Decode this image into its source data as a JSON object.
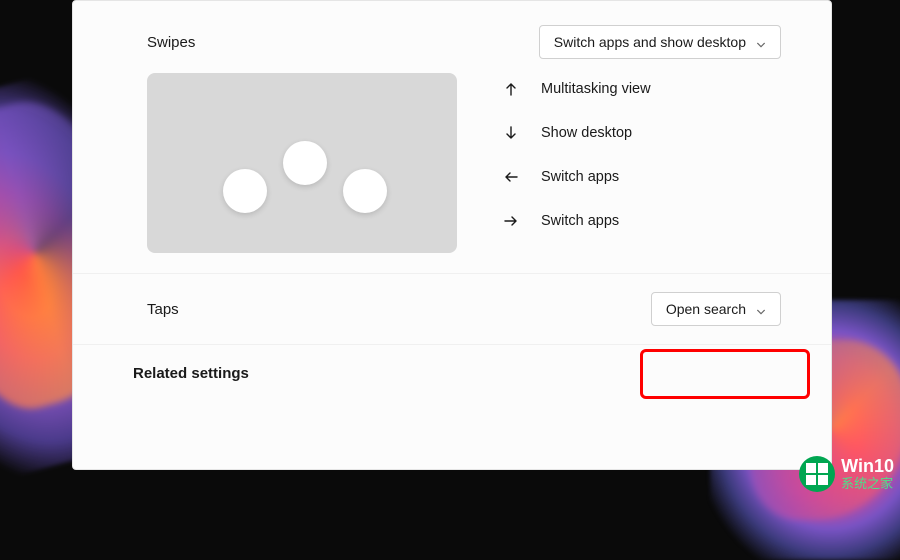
{
  "settings": {
    "swipes": {
      "label": "Swipes",
      "dropdown_value": "Switch apps and show desktop"
    },
    "gestures": [
      {
        "direction": "up",
        "label": "Multitasking view"
      },
      {
        "direction": "down",
        "label": "Show desktop"
      },
      {
        "direction": "left",
        "label": "Switch apps"
      },
      {
        "direction": "right",
        "label": "Switch apps"
      }
    ],
    "taps": {
      "label": "Taps",
      "dropdown_value": "Open search"
    },
    "related_heading": "Related settings"
  },
  "watermark": {
    "title": "Win10",
    "subtitle": "系统之家"
  },
  "colors": {
    "panel_bg": "#fcfcfc",
    "preview_bg": "#d8d8d8",
    "highlight": "#ff0000",
    "watermark_green": "#00a651"
  }
}
